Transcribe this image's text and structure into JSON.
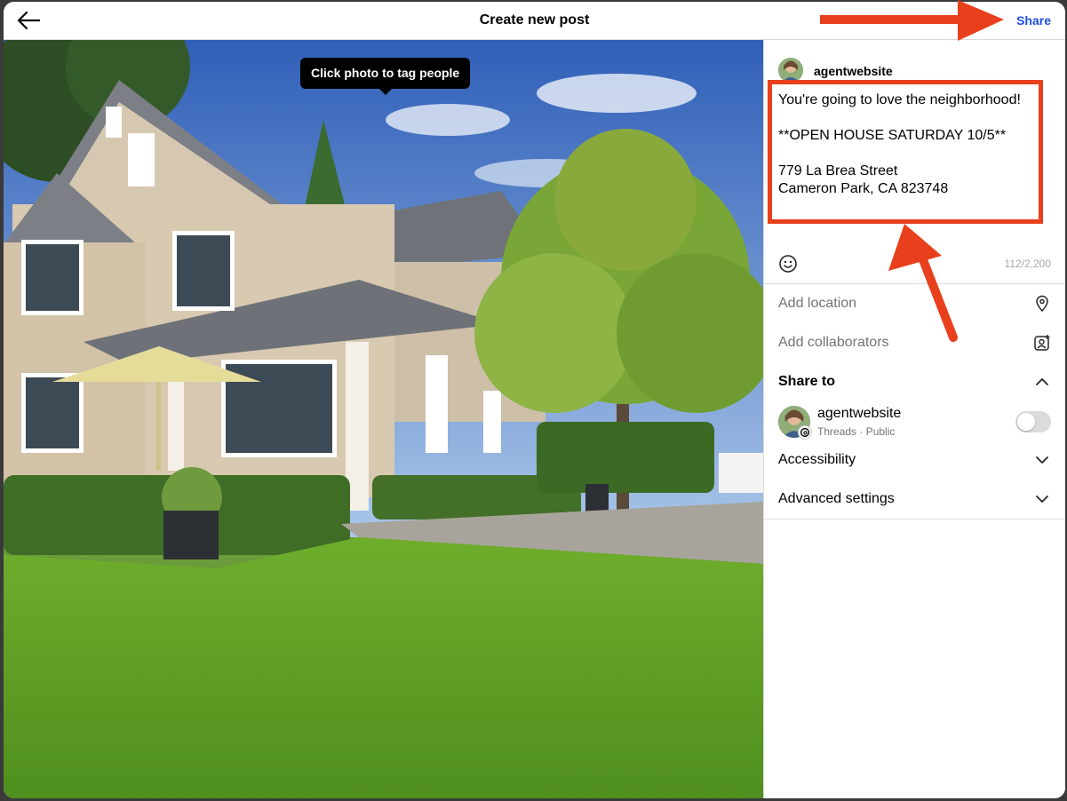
{
  "header": {
    "title": "Create new post",
    "share_label": "Share"
  },
  "photo": {
    "tooltip": "Click photo to tag people"
  },
  "user": {
    "username": "agentwebsite"
  },
  "caption": {
    "text": "You're going to love the neighborhood!\n\n**OPEN HOUSE SATURDAY 10/5**\n\n779 La Brea Street\nCameron Park, CA 823748",
    "counter": "112/2,200"
  },
  "options": {
    "add_location": "Add location",
    "add_collaborators": "Add collaborators",
    "share_to": "Share to",
    "accessibility": "Accessibility",
    "advanced_settings": "Advanced settings"
  },
  "share_account": {
    "name": "agentwebsite",
    "sub": "Threads · Public",
    "enabled": false
  },
  "colors": {
    "annotation": "#e8401c",
    "share_link": "#1f4fe0"
  }
}
